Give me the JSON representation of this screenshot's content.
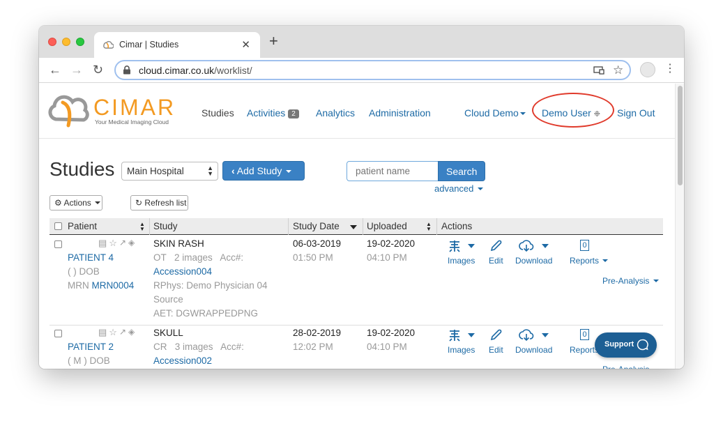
{
  "browser": {
    "tab_title": "Cimar | Studies",
    "tab_close": "✕",
    "new_tab": "+",
    "url_host": "cloud.cimar.co.uk",
    "url_path": "/worklist/"
  },
  "brand": {
    "name": "CIMAR",
    "tagline": "Your Medical Imaging Cloud",
    "accent": "#f39a22",
    "link_color": "#1d6aa5"
  },
  "nav": {
    "studies": "Studies",
    "activities": "Activities",
    "activities_count": "2",
    "analytics": "Analytics",
    "administration": "Administration",
    "org": "Cloud Demo",
    "user": "Demo User",
    "sign_out": "Sign Out"
  },
  "page": {
    "heading": "Studies",
    "location_select": "Main Hospital",
    "add_study": "Add Study",
    "search_placeholder": "patient name",
    "search_button": "Search",
    "advanced": "advanced",
    "actions_button": "Actions",
    "refresh_button": "Refresh list"
  },
  "table": {
    "columns": [
      "Patient",
      "Study",
      "Study Date",
      "Uploaded",
      "Actions"
    ],
    "action_labels": {
      "images": "Images",
      "edit": "Edit",
      "download": "Download",
      "reports": "Reports",
      "pre_analysis": "Pre-Analysis"
    },
    "rows": [
      {
        "patient": "PATIENT 4",
        "sex_dob": "( ) DOB",
        "mrn_label": "MRN",
        "mrn": "MRN0004",
        "study": "SKIN RASH",
        "modality": "OT",
        "images": "2 images",
        "acc_label": "Acc#:",
        "accession": "Accession004",
        "rphys": "RPhys: Demo Physician 04",
        "source": "Source",
        "aet": "AET: DGWRAPPEDPNG",
        "study_date": "06-03-2019",
        "study_time": "01:50 PM",
        "uploaded_date": "19-02-2020",
        "uploaded_time": "04:10 PM",
        "report_count": "0"
      },
      {
        "patient": "PATIENT 2",
        "sex_dob": "( M ) DOB",
        "study": "SKULL",
        "modality": "CR",
        "images": "3 images",
        "acc_label": "Acc#:",
        "accession": "Accession002",
        "study_date": "28-02-2019",
        "study_time": "12:02 PM",
        "uploaded_date": "19-02-2020",
        "uploaded_time": "04:10 PM",
        "report_count": "0"
      }
    ]
  },
  "support": {
    "label": "Support"
  }
}
